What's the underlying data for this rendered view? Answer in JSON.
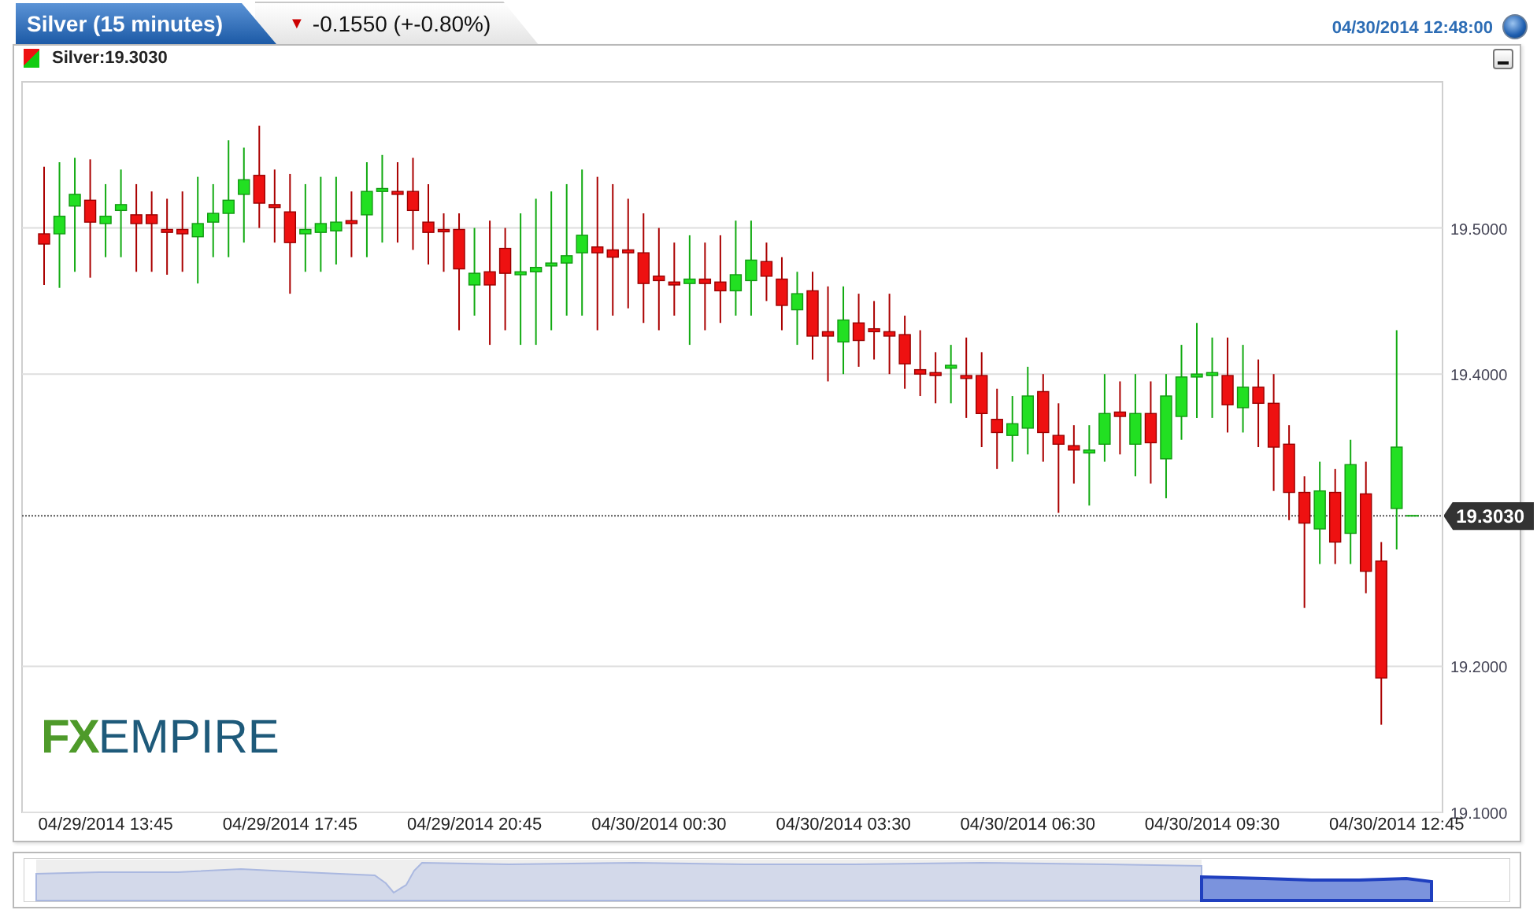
{
  "header": {
    "tabs": [
      {
        "label": "Silver (15 minutes)",
        "selected": true
      },
      {
        "arrow": "▼",
        "label": "-0.1550 (+-0.80%)",
        "selected": false
      }
    ],
    "timestamp": "04/30/2014 12:48:00"
  },
  "legend": {
    "label": "Silver:19.3030"
  },
  "chart": {
    "logo": {
      "left": "FX",
      "right": "EMPIRE"
    },
    "chart_data": {
      "type": "candlestick",
      "grid": true,
      "ylim": [
        19.1,
        19.6
      ],
      "yticks": [
        {
          "value": 19.5,
          "label": "19.5000"
        },
        {
          "value": 19.4,
          "label": "19.4000"
        },
        {
          "value": 19.2,
          "label": "19.2000"
        },
        {
          "value": 19.1,
          "label": "19.1000"
        }
      ],
      "categories": [
        null,
        null,
        null,
        null,
        "04/29/2014 13:45",
        null,
        null,
        null,
        null,
        null,
        null,
        null,
        null,
        null,
        null,
        null,
        "04/29/2014 17:45",
        null,
        null,
        null,
        null,
        null,
        null,
        null,
        null,
        null,
        null,
        null,
        "04/29/2014 20:45",
        null,
        null,
        null,
        null,
        null,
        null,
        null,
        null,
        null,
        null,
        null,
        "04/30/2014 00:30",
        null,
        null,
        null,
        null,
        null,
        null,
        null,
        null,
        null,
        null,
        null,
        "04/30/2014 03:30",
        null,
        null,
        null,
        null,
        null,
        null,
        null,
        null,
        null,
        null,
        null,
        "04/30/2014 06:30",
        null,
        null,
        null,
        null,
        null,
        null,
        null,
        null,
        null,
        null,
        null,
        "04/30/2014 09:30",
        null,
        null,
        null,
        null,
        null,
        null,
        null,
        null,
        null,
        null,
        null,
        "04/30/2014 12:45"
      ],
      "ref_lines": [
        {
          "axis": "y",
          "value": 19.303,
          "label": "19.3030"
        }
      ],
      "ohlc": [
        [
          19.496,
          19.542,
          19.461,
          19.489
        ],
        [
          19.496,
          19.545,
          19.459,
          19.508
        ],
        [
          19.515,
          19.548,
          19.47,
          19.523
        ],
        [
          19.519,
          19.547,
          19.466,
          19.504
        ],
        [
          19.503,
          19.53,
          19.48,
          19.508
        ],
        [
          19.512,
          19.54,
          19.48,
          19.516
        ],
        [
          19.509,
          19.53,
          19.47,
          19.503
        ],
        [
          19.509,
          19.525,
          19.47,
          19.503
        ],
        [
          19.499,
          19.52,
          19.468,
          19.497
        ],
        [
          19.499,
          19.525,
          19.47,
          19.496
        ],
        [
          19.494,
          19.535,
          19.462,
          19.503
        ],
        [
          19.504,
          19.53,
          19.48,
          19.51
        ],
        [
          19.51,
          19.56,
          19.48,
          19.519
        ],
        [
          19.523,
          19.555,
          19.49,
          19.533
        ],
        [
          19.536,
          19.57,
          19.5,
          19.517
        ],
        [
          19.516,
          19.54,
          19.49,
          19.514
        ],
        [
          19.511,
          19.537,
          19.455,
          19.49
        ],
        [
          19.496,
          19.53,
          19.47,
          19.499
        ],
        [
          19.497,
          19.535,
          19.47,
          19.503
        ],
        [
          19.498,
          19.535,
          19.475,
          19.504
        ],
        [
          19.505,
          19.525,
          19.48,
          19.503
        ],
        [
          19.509,
          19.545,
          19.48,
          19.525
        ],
        [
          19.525,
          19.55,
          19.49,
          19.527
        ],
        [
          19.525,
          19.545,
          19.49,
          19.523
        ],
        [
          19.525,
          19.548,
          19.485,
          19.512
        ],
        [
          19.504,
          19.53,
          19.475,
          19.497
        ],
        [
          19.499,
          19.51,
          19.47,
          19.498
        ],
        [
          19.499,
          19.51,
          19.43,
          19.472
        ],
        [
          19.461,
          19.5,
          19.44,
          19.469
        ],
        [
          19.47,
          19.505,
          19.42,
          19.461
        ],
        [
          19.486,
          19.5,
          19.43,
          19.469
        ],
        [
          19.468,
          19.51,
          19.42,
          19.47
        ],
        [
          19.47,
          19.52,
          19.42,
          19.473
        ],
        [
          19.474,
          19.525,
          19.43,
          19.476
        ],
        [
          19.476,
          19.53,
          19.44,
          19.481
        ],
        [
          19.483,
          19.54,
          19.44,
          19.495
        ],
        [
          19.487,
          19.535,
          19.43,
          19.483
        ],
        [
          19.485,
          19.53,
          19.44,
          19.48
        ],
        [
          19.485,
          19.52,
          19.445,
          19.483
        ],
        [
          19.483,
          19.51,
          19.435,
          19.462
        ],
        [
          19.467,
          19.5,
          19.43,
          19.464
        ],
        [
          19.463,
          19.49,
          19.44,
          19.461
        ],
        [
          19.462,
          19.495,
          19.42,
          19.465
        ],
        [
          19.465,
          19.49,
          19.43,
          19.462
        ],
        [
          19.463,
          19.495,
          19.435,
          19.457
        ],
        [
          19.457,
          19.505,
          19.44,
          19.468
        ],
        [
          19.464,
          19.505,
          19.44,
          19.478
        ],
        [
          19.477,
          19.49,
          19.45,
          19.467
        ],
        [
          19.465,
          19.48,
          19.43,
          19.447
        ],
        [
          19.444,
          19.47,
          19.42,
          19.455
        ],
        [
          19.457,
          19.47,
          19.41,
          19.426
        ],
        [
          19.429,
          19.46,
          19.395,
          19.426
        ],
        [
          19.422,
          19.46,
          19.4,
          19.437
        ],
        [
          19.435,
          19.455,
          19.405,
          19.423
        ],
        [
          19.431,
          19.45,
          19.41,
          19.429
        ],
        [
          19.429,
          19.455,
          19.4,
          19.426
        ],
        [
          19.427,
          19.44,
          19.39,
          19.407
        ],
        [
          19.403,
          19.43,
          19.385,
          19.4
        ],
        [
          19.401,
          19.415,
          19.38,
          19.399
        ],
        [
          19.404,
          19.42,
          19.38,
          19.406
        ],
        [
          19.399,
          19.425,
          19.37,
          19.397
        ],
        [
          19.399,
          19.415,
          19.35,
          19.373
        ],
        [
          19.369,
          19.39,
          19.335,
          19.36
        ],
        [
          19.358,
          19.385,
          19.34,
          19.366
        ],
        [
          19.363,
          19.405,
          19.345,
          19.385
        ],
        [
          19.388,
          19.4,
          19.34,
          19.36
        ],
        [
          19.358,
          19.38,
          19.305,
          19.352
        ],
        [
          19.351,
          19.365,
          19.325,
          19.348
        ],
        [
          19.346,
          19.365,
          19.31,
          19.348
        ],
        [
          19.352,
          19.4,
          19.34,
          19.373
        ],
        [
          19.374,
          19.395,
          19.345,
          19.371
        ],
        [
          19.352,
          19.4,
          19.33,
          19.373
        ],
        [
          19.373,
          19.395,
          19.325,
          19.353
        ],
        [
          19.342,
          19.4,
          19.315,
          19.385
        ],
        [
          19.371,
          19.42,
          19.355,
          19.398
        ],
        [
          19.398,
          19.435,
          19.37,
          19.4
        ],
        [
          19.399,
          19.425,
          19.37,
          19.401
        ],
        [
          19.399,
          19.425,
          19.36,
          19.379
        ],
        [
          19.377,
          19.42,
          19.36,
          19.391
        ],
        [
          19.391,
          19.41,
          19.35,
          19.38
        ],
        [
          19.38,
          19.4,
          19.32,
          19.35
        ],
        [
          19.352,
          19.365,
          19.3,
          19.319
        ],
        [
          19.319,
          19.33,
          19.24,
          19.298
        ],
        [
          19.294,
          19.34,
          19.27,
          19.32
        ],
        [
          19.319,
          19.335,
          19.27,
          19.285
        ],
        [
          19.291,
          19.355,
          19.27,
          19.338
        ],
        [
          19.318,
          19.34,
          19.25,
          19.265
        ],
        [
          19.272,
          19.285,
          19.16,
          19.192
        ],
        [
          19.308,
          19.43,
          19.28,
          19.35
        ]
      ]
    }
  }
}
